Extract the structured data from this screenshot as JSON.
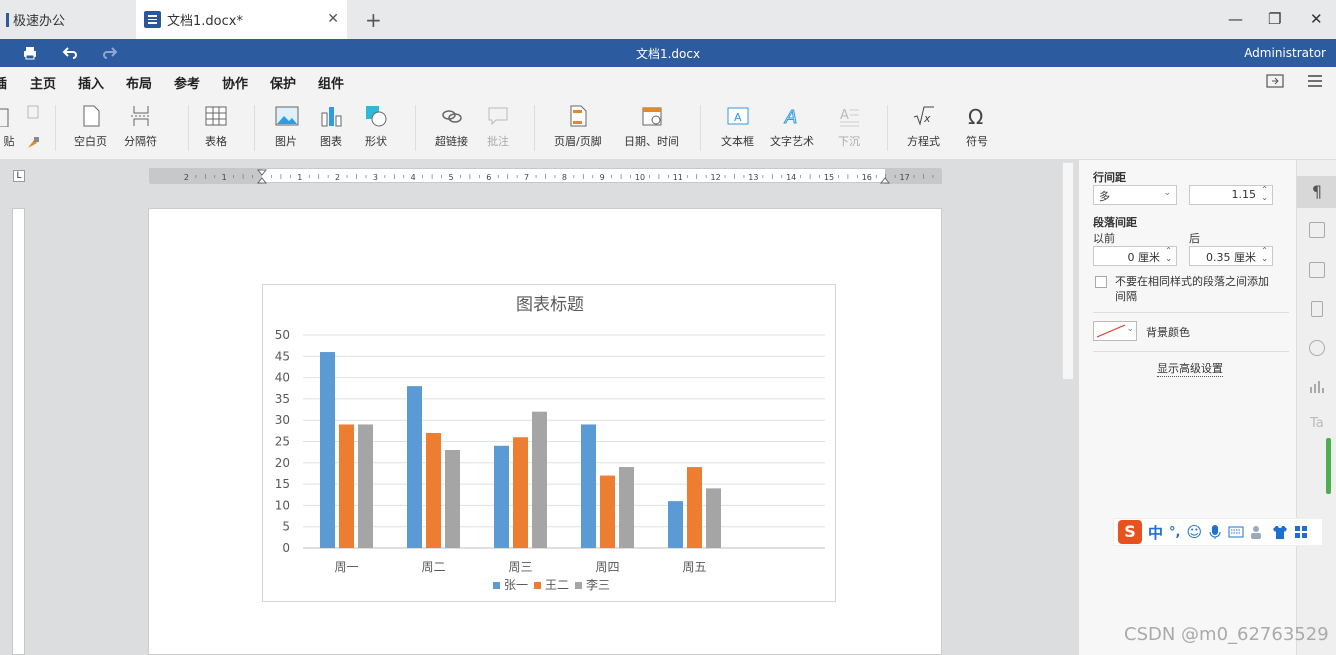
{
  "tabs": [
    {
      "label": "极速办公"
    },
    {
      "label": "文档1.docx*"
    }
  ],
  "window": {
    "title": "文档1.docx",
    "user": "Administrator",
    "minimize": "—",
    "restore": "❐",
    "close": "✕",
    "new_tab": "+"
  },
  "menu": [
    "插入",
    "主页",
    "插入",
    "布局",
    "参考",
    "协作",
    "保护",
    "组件"
  ],
  "menu_visible": {
    "first_partial": "插",
    "home": "主页",
    "insert": "插入",
    "layout": "布局",
    "ref": "参考",
    "collab": "协作",
    "protect": "保护",
    "plugins": "组件"
  },
  "ribbon": {
    "paste": "贴",
    "blank_page": "空白页",
    "page_break": "分隔符",
    "table": "表格",
    "image": "图片",
    "chart": "图表",
    "shape": "形状",
    "hyperlink": "超链接",
    "comment": "批注",
    "header_footer": "页眉/页脚",
    "datetime": "日期、时间",
    "textbox": "文本框",
    "textart": "文字艺术",
    "dropcap": "下沉",
    "equation": "方程式",
    "symbol": "符号"
  },
  "ruler_numbers": [
    "2",
    "1",
    "1",
    "2",
    "3",
    "4",
    "5",
    "6",
    "7",
    "8",
    "9",
    "10",
    "11",
    "12",
    "13",
    "14",
    "15",
    "16",
    "17"
  ],
  "panel": {
    "line_spacing_label": "行间距",
    "line_spacing_mode": "多",
    "line_spacing_value": "1.15",
    "para_spacing_label": "段落间距",
    "before_label": "以前",
    "after_label": "后",
    "before_value": "0 厘米",
    "after_value": "0.35 厘米",
    "no_space_same_style": "不要在相同样式的段落之间添加间隔",
    "bg_color_label": "背景颜色",
    "advanced_link": "显示高级设置"
  },
  "ime": {
    "mode": "中",
    "punct": "°,"
  },
  "watermark": "CSDN @m0_62763529",
  "colors": {
    "series1": "#5b9bd5",
    "series2": "#ed7d31",
    "series3": "#a5a5a5",
    "brand": "#2d5b9f"
  },
  "chart_data": {
    "type": "bar",
    "title": "图表标题",
    "categories": [
      "周一",
      "周二",
      "周三",
      "周四",
      "周五"
    ],
    "series": [
      {
        "name": "张一",
        "values": [
          46,
          38,
          24,
          29,
          11
        ]
      },
      {
        "name": "王二",
        "values": [
          29,
          27,
          26,
          17,
          19
        ]
      },
      {
        "name": "李三",
        "values": [
          29,
          23,
          32,
          19,
          14
        ]
      }
    ],
    "ylim": [
      0,
      50
    ],
    "yticks": [
      0,
      5,
      10,
      15,
      20,
      25,
      30,
      35,
      40,
      45,
      50
    ],
    "grid": true,
    "legend": "bottom"
  }
}
